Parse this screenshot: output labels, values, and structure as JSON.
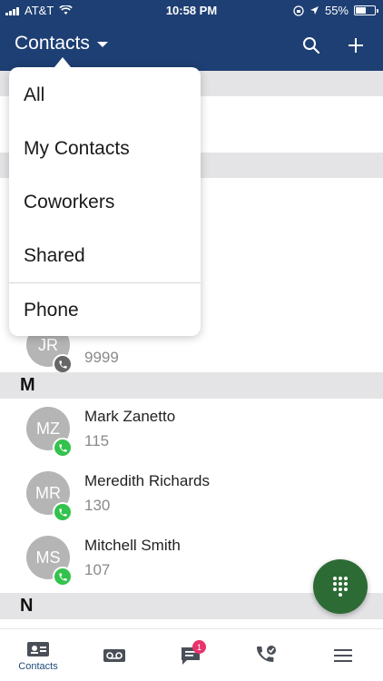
{
  "status_bar": {
    "carrier": "AT&T",
    "time": "10:58 PM",
    "battery": "55%",
    "battery_level": 0.55
  },
  "header": {
    "title": "Contacts",
    "icons": [
      "search-icon",
      "plus-icon"
    ]
  },
  "dropdown": {
    "items": [
      "All",
      "My Contacts",
      "Coworkers",
      "Shared",
      "Phone"
    ]
  },
  "partial_contact": {
    "initials": "JR",
    "ext": "9999"
  },
  "sections": {
    "m_label": "M",
    "n_label": "N"
  },
  "contacts_m": [
    {
      "initials": "MZ",
      "name": "Mark Zanetto",
      "ext": "115"
    },
    {
      "initials": "MR",
      "name": "Meredith Richards",
      "ext": "130"
    },
    {
      "initials": "MS",
      "name": "Mitchell Smith",
      "ext": "107"
    }
  ],
  "tabs": [
    {
      "label": "Contacts",
      "icon": "contacts-card-icon"
    },
    {
      "label": "",
      "icon": "voicemail-icon"
    },
    {
      "label": "",
      "icon": "chat-icon",
      "badge": "1"
    },
    {
      "label": "",
      "icon": "call-history-icon"
    },
    {
      "label": "",
      "icon": "menu-icon"
    }
  ],
  "colors": {
    "header": "#1e3f73",
    "accent_green": "#33c24d",
    "fab": "#2d6b35",
    "badge": "#e8336b",
    "section_bg": "#e4e4e6"
  }
}
